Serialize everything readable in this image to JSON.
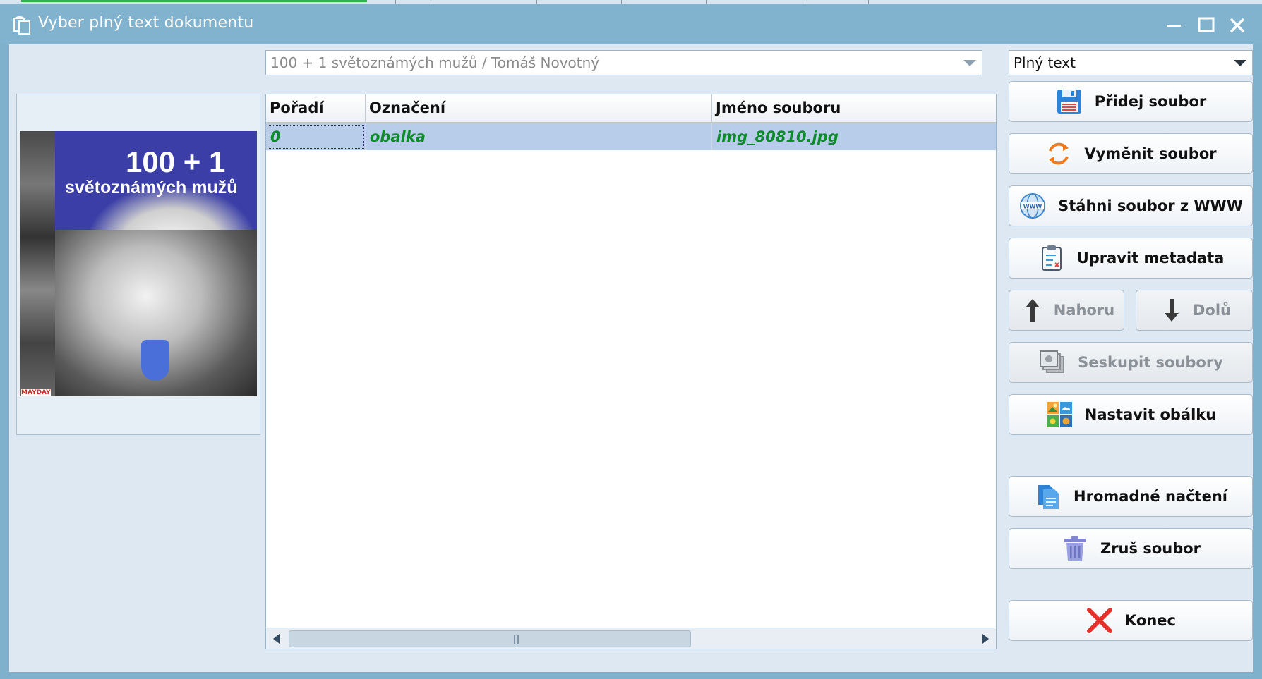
{
  "window": {
    "title": "Vyber plný text dokumentu"
  },
  "document_combo": {
    "value": "100 + 1 světoznámých mužů / Tomáš Novotný"
  },
  "type_combo": {
    "value": "Plný text"
  },
  "cover": {
    "line1": "100 + 1",
    "line2": "světoznámých mužů",
    "publisher": "MAYDAY"
  },
  "grid": {
    "columns": [
      "Pořadí",
      "Označení",
      "Jméno souboru"
    ],
    "rows": [
      {
        "order": "0",
        "label": "obalka",
        "filename": "img_80810.jpg"
      }
    ]
  },
  "buttons": {
    "add_file": "Přidej soubor",
    "replace_file": "Vyměnit soubor",
    "download_www": "Stáhni soubor z WWW",
    "edit_metadata": "Upravit metadata",
    "up": "Nahoru",
    "down": "Dolů",
    "group_files": "Seskupit soubory",
    "set_cover": "Nastavit obálku",
    "bulk_load": "Hromadné načtení",
    "delete_file": "Zruš soubor",
    "close": "Konec"
  },
  "colors": {
    "titlebar": "#81b2ce",
    "selected_row": "#b7cdea",
    "row_text": "#0d8a2a",
    "close_x": "#e8302a"
  }
}
